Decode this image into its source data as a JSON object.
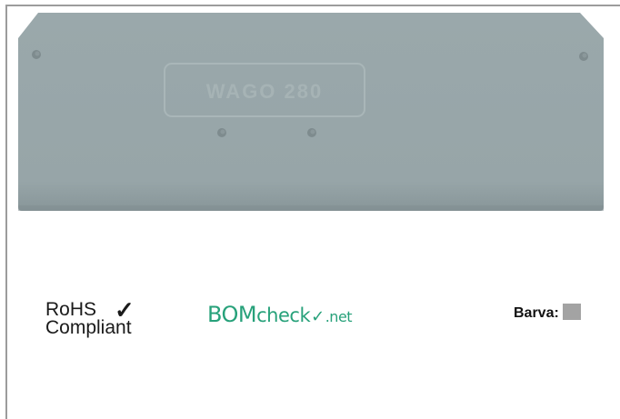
{
  "product": {
    "embossed_text": "WAGO 280",
    "color": "#98a6a8"
  },
  "badges": {
    "rohs_line1": "RoHS",
    "rohs_line2": "Compliant",
    "rohs_check": "✓",
    "bomcheck_part1": "BOM",
    "bomcheck_part2": "check",
    "bomcheck_tick": "✓",
    "bomcheck_part3": ".net"
  },
  "color_label": "Barva:",
  "swatch_color": "#a3a3a3"
}
